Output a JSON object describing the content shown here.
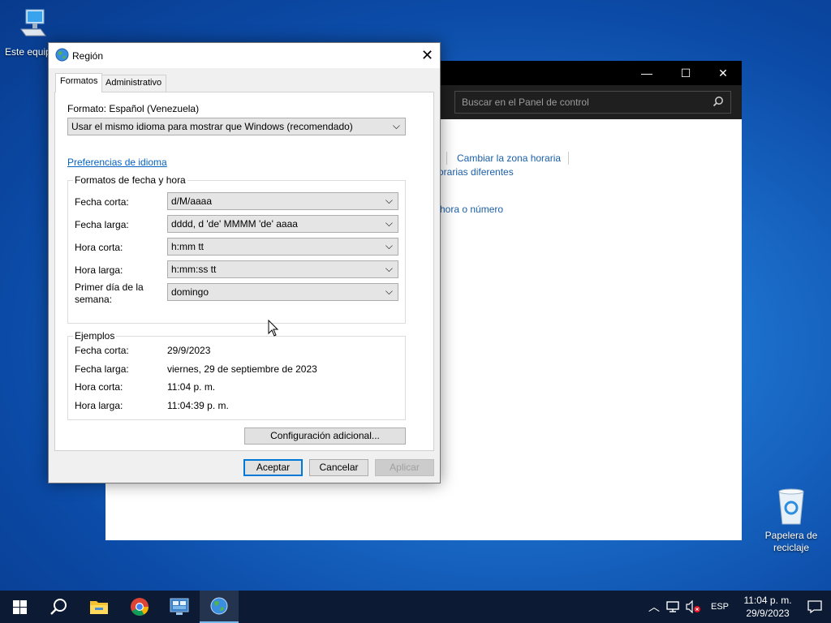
{
  "desktop": {
    "this_pc_label": "Este equipo",
    "recycle_bin_label_1": "Papelera de",
    "recycle_bin_label_2": "reciclaje"
  },
  "control_panel": {
    "search_placeholder": "Buscar en el Panel de control",
    "link_time_zone": "Cambiar la zona horaria",
    "link_partial_1": "orarias diferentes",
    "link_partial_2": "hora o número"
  },
  "dialog": {
    "title": "Región",
    "tabs": [
      "Formatos",
      "Administrativo"
    ],
    "format_label": "Formato: Español (Venezuela)",
    "format_select": "Usar el mismo idioma para mostrar que Windows (recomendado)",
    "language_prefs_link": "Preferencias de idioma",
    "date_time_group": "Formatos de fecha y hora",
    "short_date_label": "Fecha corta:",
    "short_date_value": "d/M/aaaa",
    "long_date_label": "Fecha larga:",
    "long_date_value": "dddd, d 'de' MMMM 'de' aaaa",
    "short_time_label": "Hora corta:",
    "short_time_value": "h:mm tt",
    "long_time_label": "Hora larga:",
    "long_time_value": "h:mm:ss tt",
    "first_day_label_1": "Primer día de la",
    "first_day_label_2": "semana:",
    "first_day_value": "domingo",
    "examples_group": "Ejemplos",
    "ex_short_date_label": "Fecha corta:",
    "ex_short_date_value": "29/9/2023",
    "ex_long_date_label": "Fecha larga:",
    "ex_long_date_value": "viernes, 29 de septiembre de 2023",
    "ex_short_time_label": "Hora corta:",
    "ex_short_time_value": "11:04 p. m.",
    "ex_long_time_label": "Hora larga:",
    "ex_long_time_value": "11:04:39 p. m.",
    "additional_settings_button": "Configuración adicional...",
    "ok_button": "Aceptar",
    "cancel_button": "Cancelar",
    "apply_button": "Aplicar"
  },
  "taskbar": {
    "language": "ESP",
    "time": "11:04 p. m.",
    "date": "29/9/2023"
  }
}
